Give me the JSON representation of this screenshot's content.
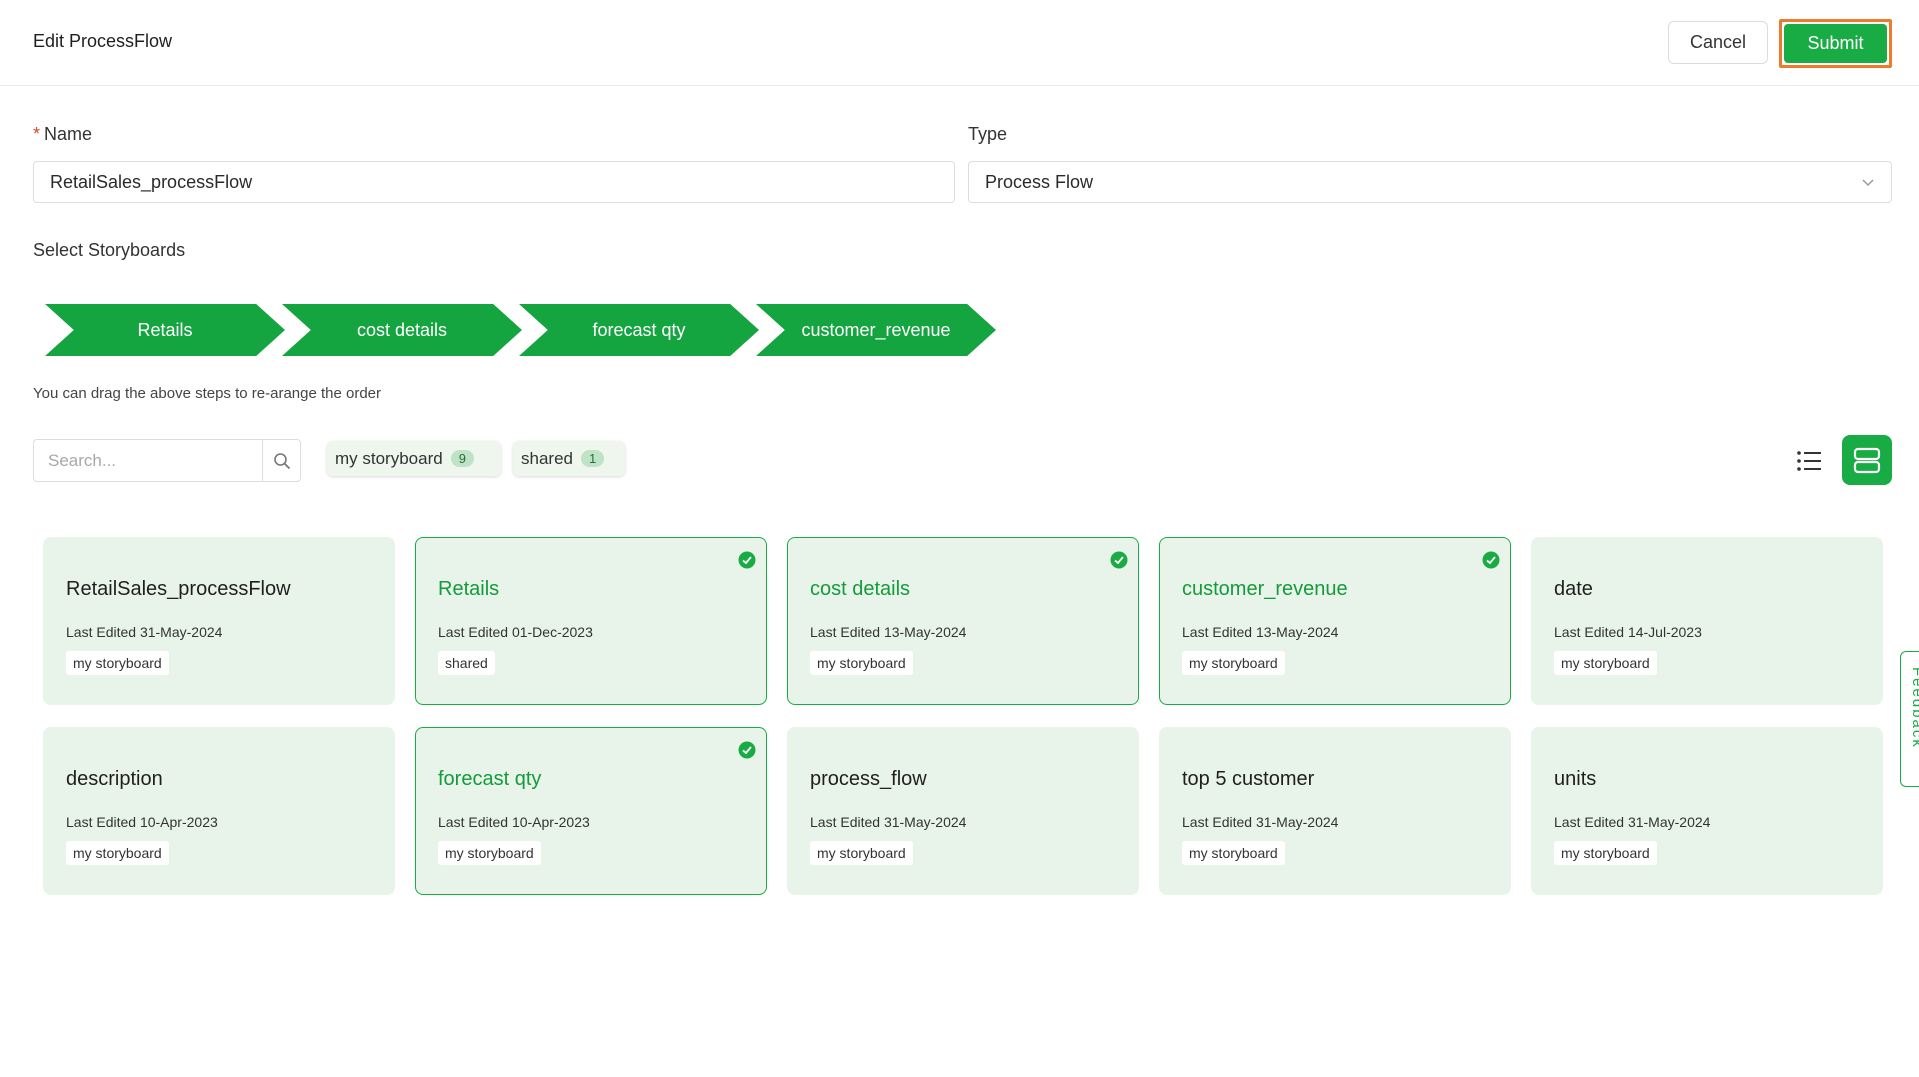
{
  "header": {
    "title": "Edit ProcessFlow",
    "cancel_label": "Cancel",
    "submit_label": "Submit"
  },
  "form": {
    "name_label": "Name",
    "name_value": "RetailSales_processFlow",
    "type_label": "Type",
    "type_value": "Process Flow",
    "storyboards_label": "Select Storyboards"
  },
  "steps": [
    "Retails",
    "cost details",
    "forecast qty",
    "customer_revenue"
  ],
  "hint": "You can drag the above steps to re-arange the order",
  "search": {
    "placeholder": "Search..."
  },
  "filters": [
    {
      "label": "my storyboard",
      "count": "9"
    },
    {
      "label": "shared",
      "count": "1"
    }
  ],
  "cards": [
    {
      "title": "RetailSales_processFlow",
      "date": "Last Edited 31-May-2024",
      "tag": "my storyboard",
      "selected": false
    },
    {
      "title": "Retails",
      "date": "Last Edited 01-Dec-2023",
      "tag": "shared",
      "selected": true
    },
    {
      "title": "cost details",
      "date": "Last Edited 13-May-2024",
      "tag": "my storyboard",
      "selected": true
    },
    {
      "title": "customer_revenue",
      "date": "Last Edited 13-May-2024",
      "tag": "my storyboard",
      "selected": true
    },
    {
      "title": "date",
      "date": "Last Edited 14-Jul-2023",
      "tag": "my storyboard",
      "selected": false
    },
    {
      "title": "description",
      "date": "Last Edited 10-Apr-2023",
      "tag": "my storyboard",
      "selected": false
    },
    {
      "title": "forecast qty",
      "date": "Last Edited 10-Apr-2023",
      "tag": "my storyboard",
      "selected": true
    },
    {
      "title": "process_flow",
      "date": "Last Edited 31-May-2024",
      "tag": "my storyboard",
      "selected": false
    },
    {
      "title": "top 5 customer",
      "date": "Last Edited 31-May-2024",
      "tag": "my storyboard",
      "selected": false
    },
    {
      "title": "units",
      "date": "Last Edited 31-May-2024",
      "tag": "my storyboard",
      "selected": false
    }
  ],
  "feedback": {
    "label": "Feedback"
  },
  "colors": {
    "accent": "#1aac44",
    "card_bg": "#e8f4e9",
    "highlight": "#f07a2b"
  },
  "icons": {
    "search": "search-icon",
    "list_view": "list-view-icon",
    "card_view": "card-view-icon",
    "selected": "check-circle-icon",
    "dropdown": "chevron-down-icon"
  }
}
